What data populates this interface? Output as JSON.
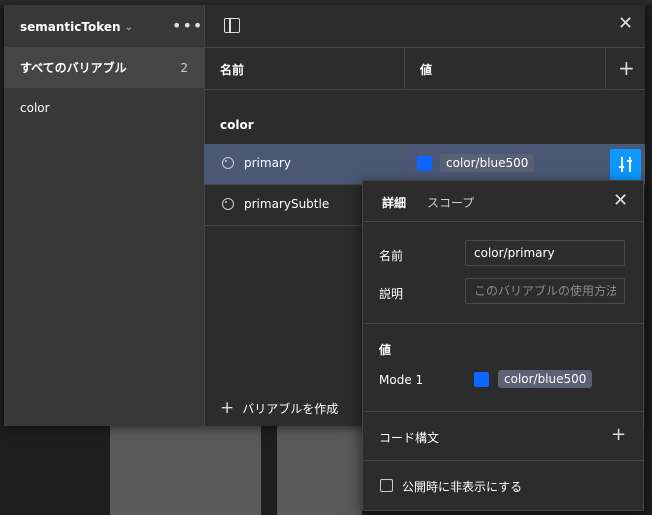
{
  "sidebar": {
    "collection_name": "semanticToken",
    "more_label": "•••",
    "all_variables_label": "すべてのバリアブル",
    "all_variables_count": "2",
    "groups": [
      {
        "label": "color"
      }
    ]
  },
  "table": {
    "col_name": "名前",
    "col_value": "値",
    "group_label": "color",
    "rows": [
      {
        "name": "primary",
        "value": "color/blue500",
        "swatch_color": "#0d66ff"
      },
      {
        "name": "primarySubtle",
        "value": ""
      }
    ],
    "create_label": "バリアブルを作成"
  },
  "detail": {
    "tab_detail": "詳細",
    "tab_scope": "スコープ",
    "name_label": "名前",
    "name_value": "color/primary",
    "desc_label": "説明",
    "desc_placeholder": "このバリアブルの使用方法",
    "value_section": "値",
    "mode_label": "Mode 1",
    "mode_value": "color/blue500",
    "code_syntax_label": "コード構文",
    "hide_label": "公開時に非表示にする"
  },
  "colors": {
    "accent": "#0d99ff",
    "selected_row": "#4a5876",
    "swatch": "#0d66ff"
  }
}
